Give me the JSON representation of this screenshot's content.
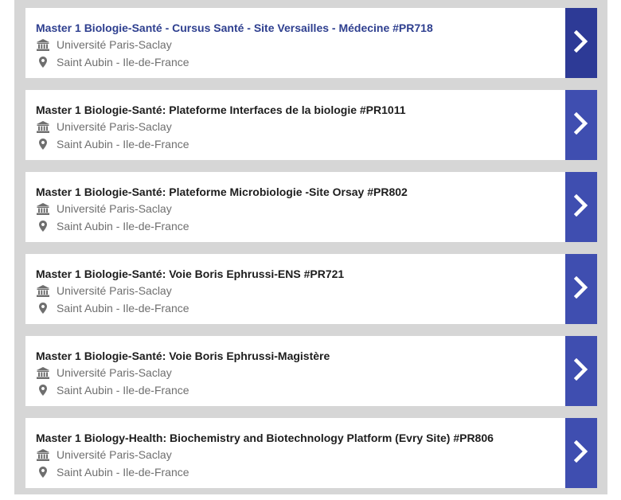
{
  "programs": [
    {
      "title": "Master 1 Biologie-Santé - Cursus Santé - Site Versailles - Médecine #PR718",
      "university": "Université Paris-Saclay",
      "location": "Saint Aubin - Ile-de-France",
      "active": true
    },
    {
      "title": "Master 1 Biologie-Santé: Plateforme Interfaces de la biologie #PR1011",
      "university": "Université Paris-Saclay",
      "location": "Saint Aubin - Ile-de-France",
      "active": false
    },
    {
      "title": "Master 1 Biologie-Santé: Plateforme Microbiologie -Site Orsay #PR802",
      "university": "Université Paris-Saclay",
      "location": "Saint Aubin - Ile-de-France",
      "active": false
    },
    {
      "title": "Master 1 Biologie-Santé: Voie Boris Ephrussi-ENS #PR721",
      "university": "Université Paris-Saclay",
      "location": "Saint Aubin - Ile-de-France",
      "active": false
    },
    {
      "title": "Master 1 Biologie-Santé: Voie Boris Ephrussi-Magistère",
      "university": "Université Paris-Saclay",
      "location": "Saint Aubin - Ile-de-France",
      "active": false
    },
    {
      "title": "Master 1 Biology-Health: Biochemistry and Biotechnology Platform (Evry Site) #PR806",
      "university": "Université Paris-Saclay",
      "location": "Saint Aubin - Ile-de-France",
      "active": false
    }
  ],
  "icons": {
    "university": "university-icon",
    "location": "map-pin-icon",
    "open": "chevron-right-icon"
  },
  "colors": {
    "accent": "#3f4eb0",
    "accent_active": "#2d3a96",
    "title_active": "#2e3f8f",
    "panel": "#d6d6d6"
  }
}
